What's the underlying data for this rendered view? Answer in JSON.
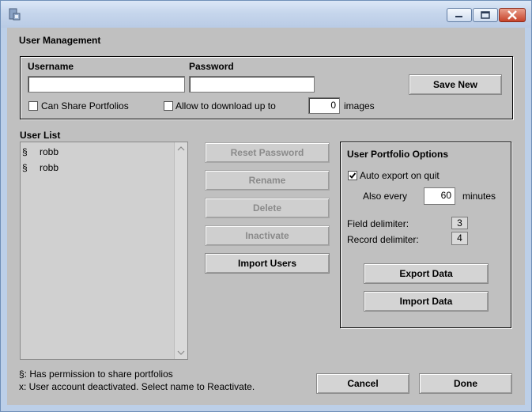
{
  "section_title": "User Management",
  "fields": {
    "username_label": "Username",
    "password_label": "Password",
    "username_value": "",
    "password_value": "",
    "can_share_label": "Can Share Portfolios",
    "allow_download_label": "Allow to download up to",
    "download_count": "0",
    "images_label": "images",
    "save_new": "Save New"
  },
  "user_list": {
    "label": "User List",
    "items": [
      {
        "mark": "§",
        "name": "robb"
      },
      {
        "mark": "§",
        "name": "robb"
      }
    ]
  },
  "actions": {
    "reset_password": "Reset Password",
    "rename": "Rename",
    "delete": "Delete",
    "inactivate": "Inactivate",
    "import_users": "Import Users"
  },
  "portfolio_options": {
    "title": "User Portfolio Options",
    "auto_export_label": "Auto export on quit",
    "auto_export_checked": true,
    "also_every_label": "Also every",
    "minutes_value": "60",
    "minutes_label": "minutes",
    "field_delim_label": "Field delimiter:",
    "field_delim_value": "3",
    "record_delim_label": "Record delimiter:",
    "record_delim_value": "4",
    "export_data": "Export Data",
    "import_data": "Import Data"
  },
  "legend": {
    "line1": "§: Has permission to share portfolios",
    "line2": "x: User account deactivated.  Select name to Reactivate."
  },
  "footer": {
    "cancel": "Cancel",
    "done": "Done"
  },
  "colors": {
    "background": "#c0c0c0",
    "titlebar": "#c6d6ec",
    "close_button": "#c7432a"
  }
}
